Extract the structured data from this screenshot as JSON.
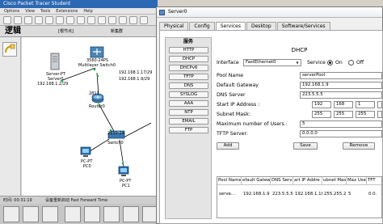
{
  "packet_tracer": {
    "title": "Cisco Packet Tracer Student",
    "menu": [
      "Options",
      "View",
      "Tools",
      "Extensions",
      "Help"
    ],
    "logical_label": "逻辑",
    "root_label": "[根节点]",
    "new_cluster_label": "新集群",
    "status_time": "时间: 00:31:19",
    "status_mode": "设备重新启动  Fast Forward Time"
  },
  "topology": {
    "server_type": "Server-PT",
    "server_name": "Server0",
    "server_ip": "192.168.1.2/29",
    "multilayer_model": "3560-24PS",
    "multilayer_name": "Multilayer Switch0",
    "link_ip_1": "192.168.1.17/29",
    "link_ip_2": "192.168.1.9/29",
    "router_model": "2811",
    "router_name": "Router0",
    "switch_model": "2950-24",
    "switch_name": "Switch0",
    "pc0_type": "PC-PT",
    "pc0_name": "PC0",
    "pc1_type": "PC-PT",
    "pc1_name": "PC1"
  },
  "dialog": {
    "title": "Server0",
    "tabs": [
      "Physical",
      "Config",
      "Services",
      "Desktop",
      "Software/Services"
    ],
    "active_tab": "Services"
  },
  "services": {
    "header": "服务",
    "items": [
      "HTTP",
      "DHCP",
      "DHCPv6",
      "TFTP",
      "DNS",
      "SYSLOG",
      "AAA",
      "NTP",
      "EMAIL",
      "FTP"
    ]
  },
  "dhcp": {
    "title": "DHCP",
    "interface_label": "Interface",
    "interface_value": "FastEthernet0",
    "service_label": "Service",
    "on_label": "On",
    "off_label": "Off",
    "service_state": "on",
    "pool_name_label": "Pool Name",
    "pool_name_value": "serverPool",
    "gateway_label": "Default Gateway",
    "gateway_value": "192.168.1.9",
    "dns_label": "DNS Server",
    "dns_value": "223.5.5.5",
    "start_ip_label": "Start IP Address :",
    "start_ip": [
      "192",
      "168",
      "1"
    ],
    "subnet_label": "Subnet Mask:",
    "subnet": [
      "255",
      "255",
      "255"
    ],
    "max_users_label": "Maximum number of Users :",
    "max_users_value": "5",
    "tftp_label": "TFTP Server:",
    "tftp_value": "0.0.0.0",
    "add_label": "Add",
    "save_label": "Save",
    "remove_label": "Remove",
    "columns": [
      "Pool Name",
      "efault Gatewa",
      "DNS Serve",
      "art IP Addre",
      "ubnet Mas",
      "Max Use",
      "TFT"
    ],
    "rows": [
      [
        "serve...",
        "192.168.1.9",
        "223.5.5.5",
        "192.168.1.18",
        "255.255.2...",
        "5",
        "0.0."
      ]
    ]
  }
}
